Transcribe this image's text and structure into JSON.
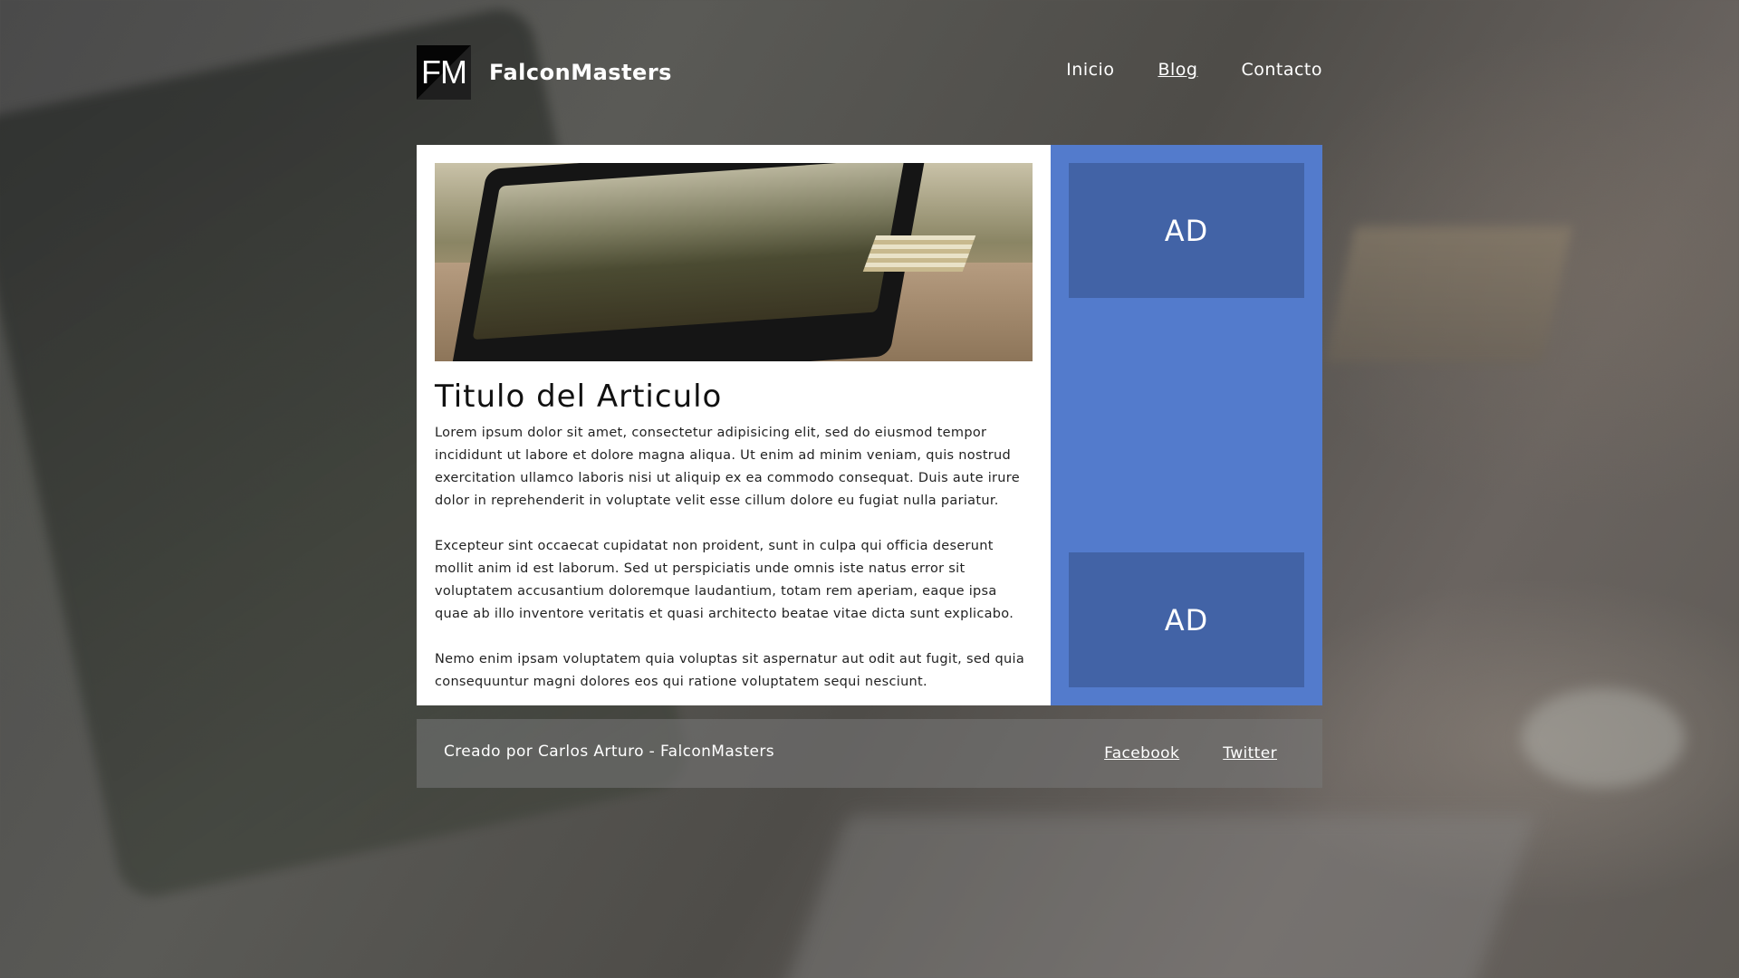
{
  "header": {
    "logo_text": "FM",
    "brand_name": "FalconMasters",
    "nav": [
      {
        "label": "Inicio"
      },
      {
        "label": "Blog",
        "active": true
      },
      {
        "label": "Contacto"
      }
    ]
  },
  "article": {
    "image_icon": "laptop-photo",
    "title": "Titulo del Articulo",
    "paragraphs": [
      "Lorem ipsum dolor sit amet, consectetur adipisicing elit, sed do eiusmod tempor incididunt ut labore et dolore magna aliqua. Ut enim ad minim veniam, quis nostrud exercitation ullamco laboris nisi ut aliquip ex ea commodo consequat. Duis aute irure dolor in reprehenderit in voluptate velit esse cillum dolore eu fugiat nulla pariatur.",
      "Excepteur sint occaecat cupidatat non proident, sunt in culpa qui officia deserunt mollit anim id est laborum. Sed ut perspiciatis unde omnis iste natus error sit voluptatem accusantium doloremque laudantium, totam rem aperiam, eaque ipsa quae ab illo inventore veritatis et quasi architecto beatae vitae dicta sunt explicabo.",
      "Nemo enim ipsam voluptatem quia voluptas sit aspernatur aut odit aut fugit, sed quia consequuntur magni dolores eos qui ratione voluptatem sequi nesciunt."
    ]
  },
  "sidebar": {
    "ads": [
      {
        "label": "AD"
      },
      {
        "label": "AD"
      }
    ]
  },
  "footer": {
    "credit": "Creado por Carlos Arturo - FalconMasters",
    "links": [
      {
        "label": "Facebook"
      },
      {
        "label": "Twitter"
      }
    ]
  },
  "colors": {
    "sidebar": "#537bcc",
    "ad_box": "#4263a6",
    "article_bg": "#ffffff",
    "footer_bg": "rgba(120,120,120,0.55)"
  }
}
